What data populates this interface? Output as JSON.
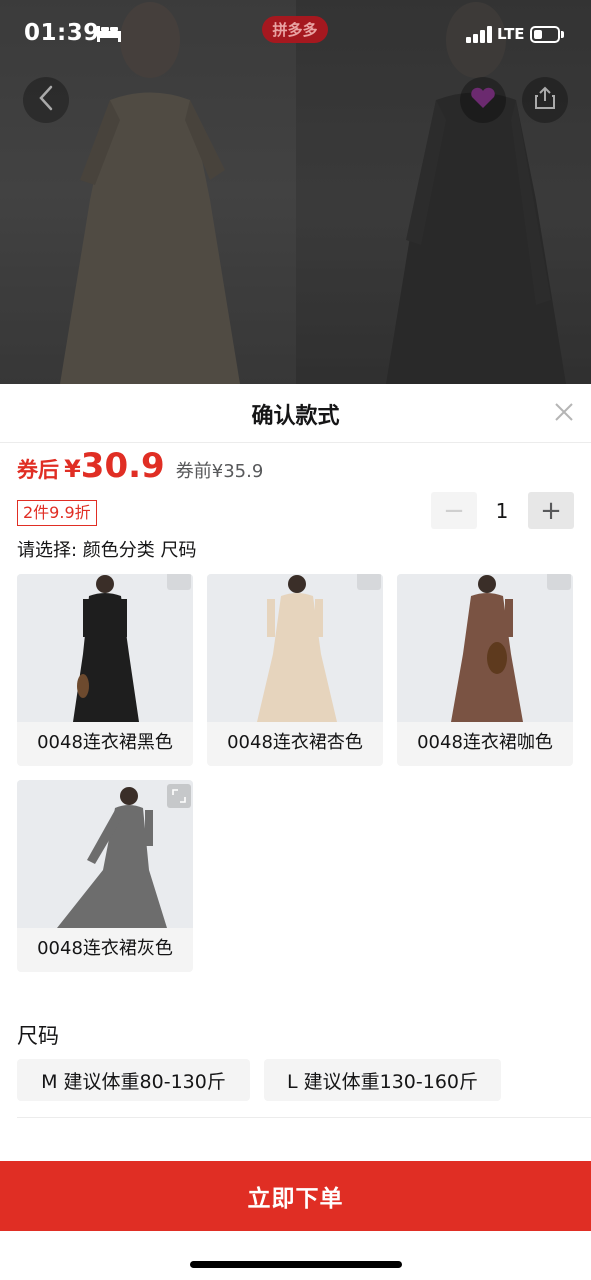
{
  "status_bar": {
    "time": "01:39",
    "network": "LTE"
  },
  "header": {
    "brand": "拼多多"
  },
  "sheet": {
    "title": "确认款式",
    "price": {
      "after_label": "券后",
      "currency": "¥",
      "after_value": "30.9",
      "before": "券前¥35.9"
    },
    "discount_badge": "2件9.9折",
    "quantity": {
      "value": "1",
      "minus": "−",
      "plus": "+"
    },
    "selection_prompt": "请选择: 颜色分类 尺码",
    "colors": [
      {
        "label": "0048连衣裙黑色",
        "swatch": "#1e1e1e"
      },
      {
        "label": "0048连衣裙杏色",
        "swatch": "#e6d4bd"
      },
      {
        "label": "0048连衣裙咖色",
        "swatch": "#7a5343"
      },
      {
        "label": "0048连衣裙灰色",
        "swatch": "#6d6d6d"
      }
    ],
    "size_section": {
      "title": "尺码",
      "options": [
        "M 建议体重80-130斤",
        "L 建议体重130-160斤"
      ]
    },
    "order_button": "立即下单"
  },
  "colors": {
    "accent": "#e02e24"
  }
}
